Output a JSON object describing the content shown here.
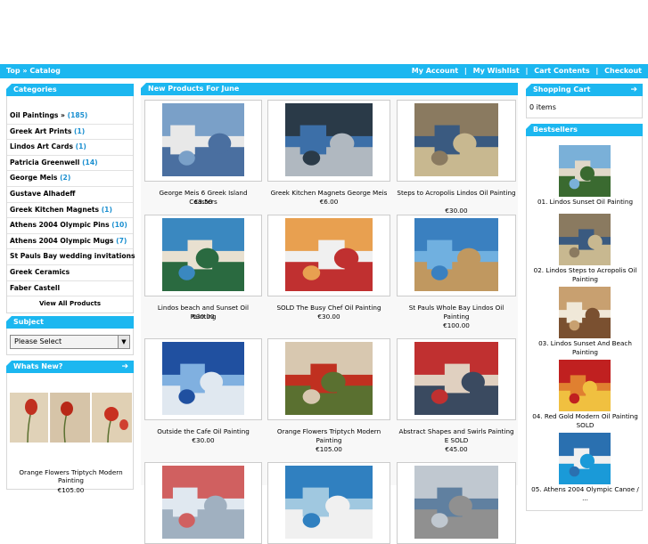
{
  "nav": {
    "breadcrumb": "Top » Catalog",
    "links": [
      "My Account",
      "My Wishlist",
      "Cart Contents",
      "Checkout"
    ],
    "separator": "|"
  },
  "categories": {
    "title": "Categories",
    "items": [
      {
        "label": "Oil Paintings »",
        "count": "(185)"
      },
      {
        "label": "Greek Art Prints",
        "count": "(1)"
      },
      {
        "label": "Lindos Art Cards",
        "count": "(1)"
      },
      {
        "label": "Patricia Greenwell",
        "count": "(14)"
      },
      {
        "label": "George Meis",
        "count": "(2)"
      },
      {
        "label": "Gustave Alhadeff",
        "count": ""
      },
      {
        "label": "Greek Kitchen Magnets",
        "count": "(1)"
      },
      {
        "label": "Athens 2004 Olympic Pins",
        "count": "(10)"
      },
      {
        "label": "Athens 2004 Olympic Mugs",
        "count": "(7)"
      },
      {
        "label": "St Pauls Bay wedding invitations",
        "count": ""
      },
      {
        "label": "Greek Ceramics",
        "count": ""
      },
      {
        "label": "Faber Castell",
        "count": ""
      }
    ],
    "view_all": "View All Products"
  },
  "subject": {
    "title": "Subject",
    "selected": "Please Select"
  },
  "whats_new": {
    "title": "Whats New?",
    "name": "Orange Flowers Triptych Modern Painting",
    "price": "€105.00"
  },
  "new_products": {
    "title": "New Products For June",
    "items": [
      {
        "name": "George Meis 6 Greek Island Coasters",
        "price": "€3.50",
        "colors": [
          "#7aa0c8",
          "#e8e8e8",
          "#4a6fa0"
        ]
      },
      {
        "name": "Greek Kitchen Magnets George Meis",
        "price": "€6.00",
        "colors": [
          "#2a3a48",
          "#3c6fa8",
          "#b0b8c0"
        ]
      },
      {
        "name": "Steps to Acropolis Lindos Oil Painting",
        "price": "€30.00",
        "colors": [
          "#8a7a60",
          "#3a5a80",
          "#c8b890"
        ]
      },
      {
        "name": "Lindos beach and Sunset Oil Painting",
        "price": "€30.00",
        "colors": [
          "#3a88c0",
          "#e8e0d0",
          "#2a6a40"
        ]
      },
      {
        "name": "SOLD The Busy Chef Oil Painting",
        "price": "€30.00",
        "colors": [
          "#e8a050",
          "#f0f0f0",
          "#c03030"
        ]
      },
      {
        "name": "St Pauls Whole Bay Lindos Oil Painting",
        "price": "€100.00",
        "colors": [
          "#3a80c0",
          "#70b0e0",
          "#c09860"
        ]
      },
      {
        "name": "Outside the Cafe Oil Painting",
        "price": "€30.00",
        "colors": [
          "#2050a0",
          "#80b0e0",
          "#e0e8f0"
        ]
      },
      {
        "name": "Orange Flowers Triptych Modern Painting",
        "price": "€105.00",
        "colors": [
          "#d8c8b0",
          "#c03020",
          "#5a7030"
        ]
      },
      {
        "name": "Abstract Shapes and Swirls Painting E SOLD",
        "price": "€45.00",
        "colors": [
          "#c03030",
          "#e0d0c0",
          "#3a4a60"
        ]
      },
      {
        "name": "",
        "price": "",
        "colors": [
          "#d06060",
          "#e0e8f0",
          "#a0b0c0"
        ]
      },
      {
        "name": "",
        "price": "",
        "colors": [
          "#3080c0",
          "#a0c8e0",
          "#f0f0f0"
        ]
      },
      {
        "name": "",
        "price": "",
        "colors": [
          "#c0c8d0",
          "#6080a0",
          "#909090"
        ]
      }
    ]
  },
  "cart": {
    "title": "Shopping Cart",
    "text": "0 items"
  },
  "bestsellers": {
    "title": "Bestsellers",
    "items": [
      {
        "label": "01. Lindos Sunset Oil Painting",
        "colors": [
          "#7ab0d8",
          "#e0d8c8",
          "#3a6a30"
        ]
      },
      {
        "label": "02. Lindos Steps to Acropolis Oil Painting",
        "colors": [
          "#8a7a60",
          "#3a5a80",
          "#c8b890"
        ]
      },
      {
        "label": "03. Lindos Sunset And Beach Painting",
        "colors": [
          "#c8a070",
          "#f0e8d8",
          "#7a5030"
        ]
      },
      {
        "label": "04. Red Gold Modern Oil Painting SOLD",
        "colors": [
          "#c02020",
          "#e08030",
          "#f0c040"
        ]
      },
      {
        "label": "05. Athens 2004 Olympic Canoe / ...",
        "colors": [
          "#2a70b0",
          "#f0f0f0",
          "#1a9ad8"
        ]
      }
    ]
  },
  "colors": {
    "accent": "#1cb7f0",
    "count": "#1a8fd0"
  }
}
